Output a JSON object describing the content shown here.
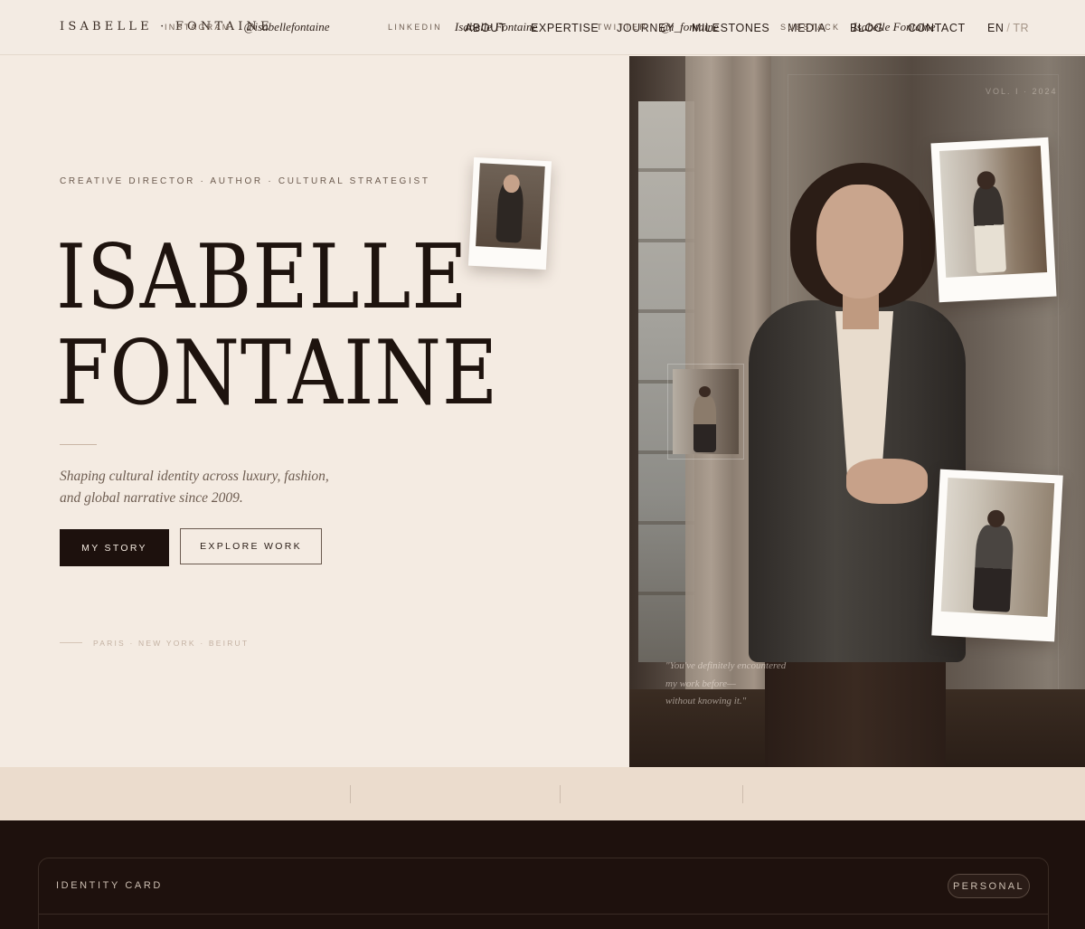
{
  "header": {
    "logo": "ISABELLE · FONTAINE",
    "nav": [
      "ABOUT",
      "EXPERTISE",
      "JOURNEY",
      "MILESTONES",
      "MEDIA",
      "BLOG",
      "CONTACT"
    ],
    "lang_active": "EN",
    "lang_sep": "/",
    "lang_alt": "TR"
  },
  "hero": {
    "eyebrow": "CREATIVE DIRECTOR · AUTHOR · CULTURAL STRATEGIST",
    "title_line1": "ISABELLE",
    "title_line2": "FONTAINE",
    "tagline_line1": "Shaping cultural identity across luxury, fashion,",
    "tagline_line2": "and global narrative since 2009.",
    "primary_button": "MY STORY",
    "secondary_button": "EXPLORE WORK",
    "cities": "PARIS · NEW YORK · BEIRUT",
    "volume": "VOL. I · 2024",
    "quote_line1": "\"You've definitely encountered",
    "quote_line2": "my work before—",
    "quote_line3": "without knowing it.\""
  },
  "social": [
    {
      "label": "INSTAGRAM",
      "value": "@isabellefontaine"
    },
    {
      "label": "LINKEDIN",
      "value": "Isabelle Fontaine"
    },
    {
      "label": "TWITTER",
      "value": "@i_fontaine"
    },
    {
      "label": "SUBSTACK",
      "value": "Isabelle Fontaine"
    }
  ],
  "identity_card": {
    "title": "IDENTITY CARD",
    "badge": "PERSONAL"
  },
  "colors": {
    "background": "#f4ebe2",
    "ink": "#1e130e",
    "dark_section": "#1e110d",
    "social_strip": "#ebdccd"
  }
}
